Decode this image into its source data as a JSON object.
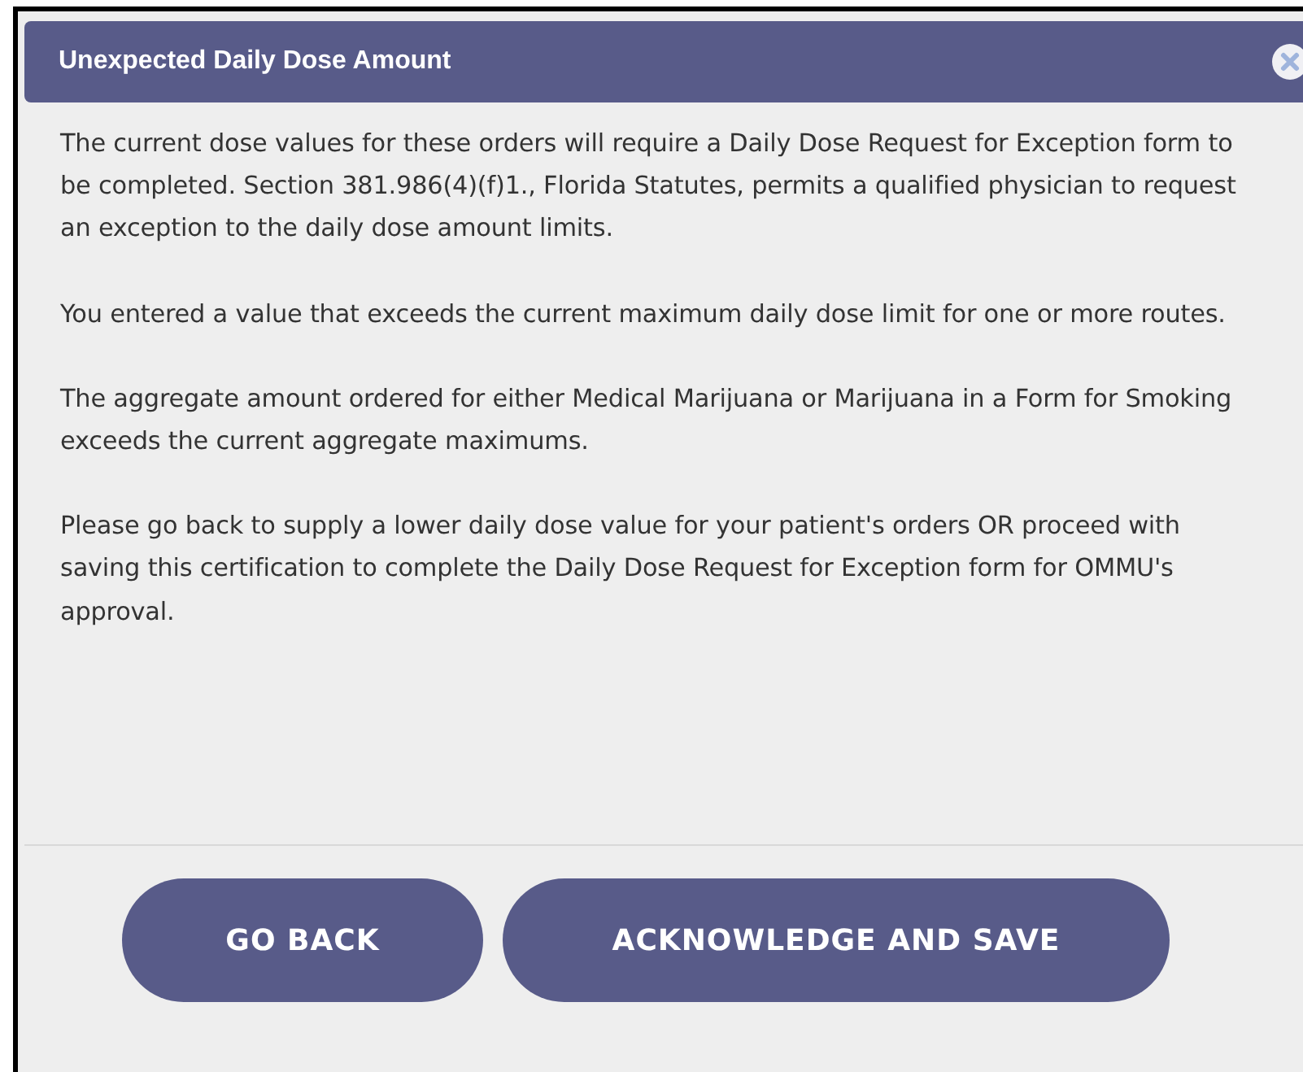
{
  "dialog": {
    "title": "Unexpected Daily Dose Amount",
    "paragraphs": [
      "The current dose values for these orders will require a Daily Dose Request for Exception form to be completed. Section 381.986(4)(f)1., Florida Statutes, permits a qualified physician to request an exception to the daily dose amount limits.",
      "You entered a value that exceeds the current maximum daily dose limit for one or more routes.",
      "The aggregate amount ordered for either Medical Marijuana or Marijuana in a Form for Smoking exceeds the current aggregate maximums.",
      "Please go back to supply a lower daily dose value for your patient's orders OR proceed with saving this certification to complete the Daily Dose Request for Exception form for OMMU's approval."
    ],
    "buttons": [
      "GO BACK",
      "ACKNOWLEDGE AND SAVE"
    ]
  }
}
